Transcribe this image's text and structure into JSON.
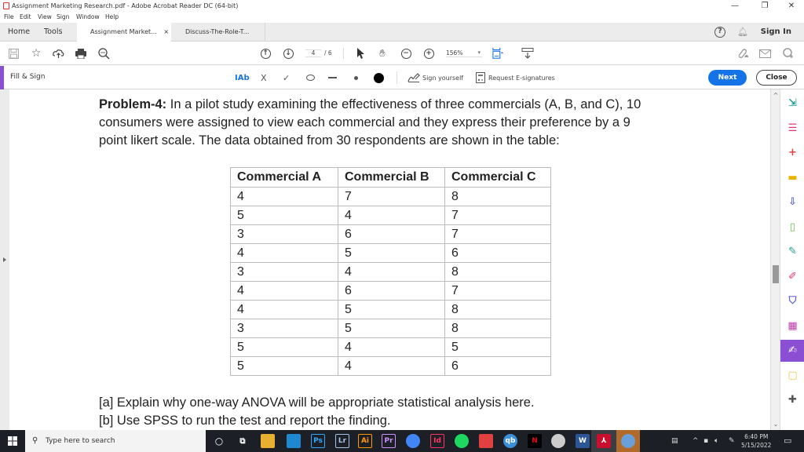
{
  "window": {
    "title": "Assignment Marketing Research.pdf - Adobe Acrobat Reader DC (64-bit)",
    "controls": {
      "minimize": "—",
      "maximize": "❐",
      "close": "✕"
    }
  },
  "menu": [
    "File",
    "Edit",
    "View",
    "Sign",
    "Window",
    "Help"
  ],
  "tabs": {
    "home": "Home",
    "tools": "Tools",
    "documents": [
      {
        "label": "Assignment Market...",
        "close": "×",
        "active": true
      },
      {
        "label": "Discuss-The-Role-T...",
        "active": false
      }
    ],
    "help_icon": "?",
    "sign_in": "Sign In"
  },
  "toolbar": {
    "page_current": "4",
    "page_total": "/ 6",
    "zoom_level": "156%",
    "zoom_dropdown": "▾"
  },
  "fill_sign": {
    "label": "Fill & Sign",
    "text_tool": "IAb",
    "cross_tool": "X",
    "check_tool": "✓",
    "sign_yourself": "Sign yourself",
    "request_esignatures": "Request E-signatures",
    "next": "Next",
    "close": "Close"
  },
  "document": {
    "problem_label": "Problem-4:",
    "problem_line1": " In a pilot study examining the effectiveness of three commercials (A, B, and C), 10",
    "problem_line2": "consumers were assigned to view each commercial and they express their preference by a 9",
    "problem_line3": "point likert scale. The data obtained from 30 respondents are shown in the table:",
    "table": {
      "headers": [
        "Commercial A",
        "Commercial B",
        "Commercial C"
      ],
      "rows": [
        [
          "4",
          "7",
          "8"
        ],
        [
          "5",
          "4",
          "7"
        ],
        [
          "3",
          "6",
          "7"
        ],
        [
          "4",
          "5",
          "6"
        ],
        [
          "3",
          "4",
          "8"
        ],
        [
          "4",
          "6",
          "7"
        ],
        [
          "4",
          "5",
          "8"
        ],
        [
          "3",
          "5",
          "8"
        ],
        [
          "5",
          "4",
          "5"
        ],
        [
          "5",
          "4",
          "6"
        ]
      ]
    },
    "question_a": "[a] Explain why one-way ANOVA will be appropriate statistical analysis here.",
    "question_b": "[b] Use SPSS to run the test and report the finding."
  },
  "right_panel_tools": [
    {
      "name": "export-pdf",
      "color": "#1a9e8f"
    },
    {
      "name": "organize-pages",
      "color": "#e0367a"
    },
    {
      "name": "create-pdf",
      "color": "#e04040"
    },
    {
      "name": "comment",
      "color": "#e8b400"
    },
    {
      "name": "combine-files",
      "color": "#5a5ee0"
    },
    {
      "name": "compress",
      "color": "#6cc04a"
    },
    {
      "name": "edit-pdf",
      "color": "#1a9e8f"
    },
    {
      "name": "fill-sign",
      "color": "#e0367a"
    },
    {
      "name": "protect",
      "color": "#5a5ee0"
    },
    {
      "name": "form",
      "color": "#c03ab0"
    },
    {
      "name": "fill-sign-active",
      "color": "#8a4fd3"
    },
    {
      "name": "send-comments",
      "color": "#e8c94a"
    },
    {
      "name": "more-tools",
      "color": "#555555"
    }
  ],
  "taskbar": {
    "search_placeholder": "Type here to search",
    "apps": [
      "Ps",
      "Lr",
      "Ai",
      "Pr",
      "Id",
      "qb",
      "N",
      "W"
    ],
    "time": "6:40 PM",
    "date": "5/15/2022"
  }
}
